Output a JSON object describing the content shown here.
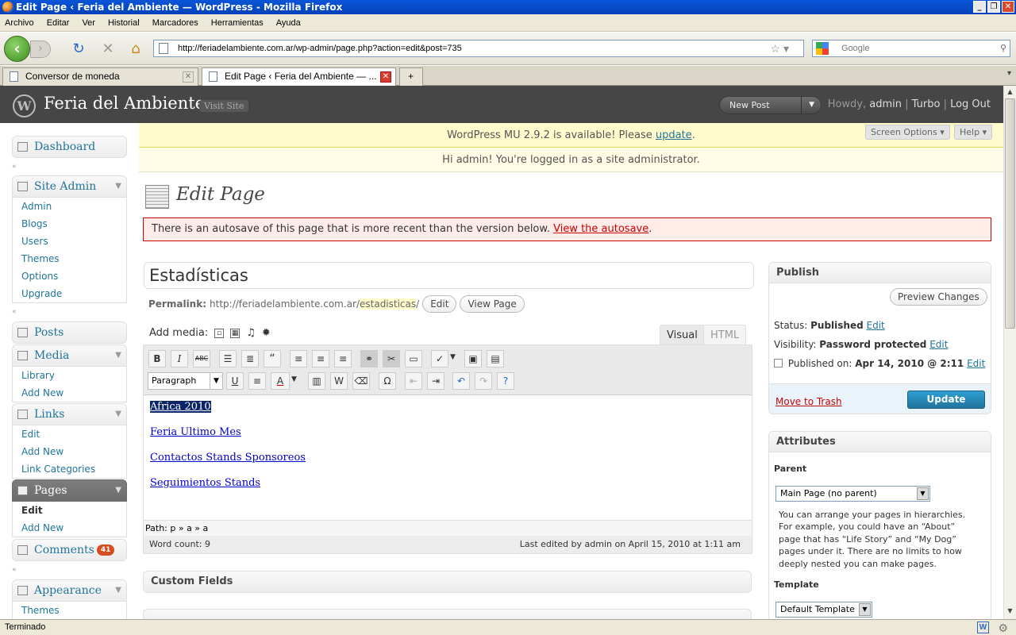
{
  "browser": {
    "window_title": "Edit Page ‹ Feria del Ambiente — WordPress - Mozilla Firefox",
    "menu": [
      "Archivo",
      "Editar",
      "Ver",
      "Historial",
      "Marcadores",
      "Herramientas",
      "Ayuda"
    ],
    "url": "http://feriadelambiente.com.ar/wp-admin/page.php?action=edit&post=735",
    "search_placeholder": "Google",
    "tabs": [
      {
        "label": "Conversor de moneda",
        "active": false
      },
      {
        "label": "Edit Page ‹ Feria del Ambiente — ...",
        "active": true
      }
    ],
    "status": "Terminado"
  },
  "wp_header": {
    "site_title": "Feria del Ambiente",
    "visit_site": "Visit Site",
    "new_post": "New Post",
    "howdy": "Howdy, ",
    "user": "admin",
    "turbo": "Turbo",
    "logout": "Log Out"
  },
  "sidebar": {
    "dashboard": "Dashboard",
    "site_admin": {
      "label": "Site Admin",
      "items": [
        "Admin",
        "Blogs",
        "Users",
        "Themes",
        "Options",
        "Upgrade"
      ]
    },
    "posts": "Posts",
    "media": {
      "label": "Media",
      "items": [
        "Library",
        "Add New"
      ]
    },
    "links": {
      "label": "Links",
      "items": [
        "Edit",
        "Add New",
        "Link Categories"
      ]
    },
    "pages": {
      "label": "Pages",
      "items": [
        "Edit",
        "Add New"
      ]
    },
    "comments": {
      "label": "Comments",
      "count": "41"
    },
    "appearance": {
      "label": "Appearance",
      "items": [
        "Themes"
      ]
    }
  },
  "notices": {
    "update_pre": "WordPress MU 2.9.2 is available! Please ",
    "update_link": "update",
    "update_post": ".",
    "admin_msg": "Hi admin! You're logged in as a site administrator.",
    "autosave_pre": "There is an autosave of this page that is more recent than the version below. ",
    "autosave_link": "View the autosave",
    "autosave_post": "."
  },
  "screen_options": "Screen Options",
  "help": "Help",
  "page": {
    "heading": "Edit Page",
    "title": "Estadísticas",
    "permalink_label": "Permalink:",
    "permalink_base": "http://feriadelambiente.com.ar/",
    "permalink_slug": "estadisticas",
    "permalink_end": "/",
    "edit_btn": "Edit",
    "view_btn": "View Page",
    "add_media": "Add media:",
    "tab_visual": "Visual",
    "tab_html": "HTML",
    "format": "Paragraph",
    "content_links": [
      "Africa 2010",
      "Feria Ultimo Mes",
      "Contactos Stands Sponsoreos",
      "Seguimientos Stands"
    ],
    "path": "Path: p » a » a",
    "word_count": "Word count: 9",
    "last_edited": "Last edited by admin on April 15, 2010 at 1:11 am",
    "custom_fields": "Custom Fields"
  },
  "publish": {
    "title": "Publish",
    "preview": "Preview Changes",
    "status_label": "Status:",
    "status_value": "Published",
    "visibility_label": "Visibility:",
    "visibility_value": "Password protected",
    "published_label": "Published on:",
    "published_value": "Apr 14, 2010 @ 2:11",
    "edit": "Edit",
    "trash": "Move to Trash",
    "update": "Update"
  },
  "attributes": {
    "title": "Attributes",
    "parent_label": "Parent",
    "parent_value": "Main Page (no parent)",
    "help": "You can arrange your pages in hierarchies. For example, you could have an “About” page that has “Life Story” and “My Dog” pages under it. There are no limits to how deeply nested you can make pages.",
    "template_label": "Template",
    "template_value": "Default Template"
  }
}
